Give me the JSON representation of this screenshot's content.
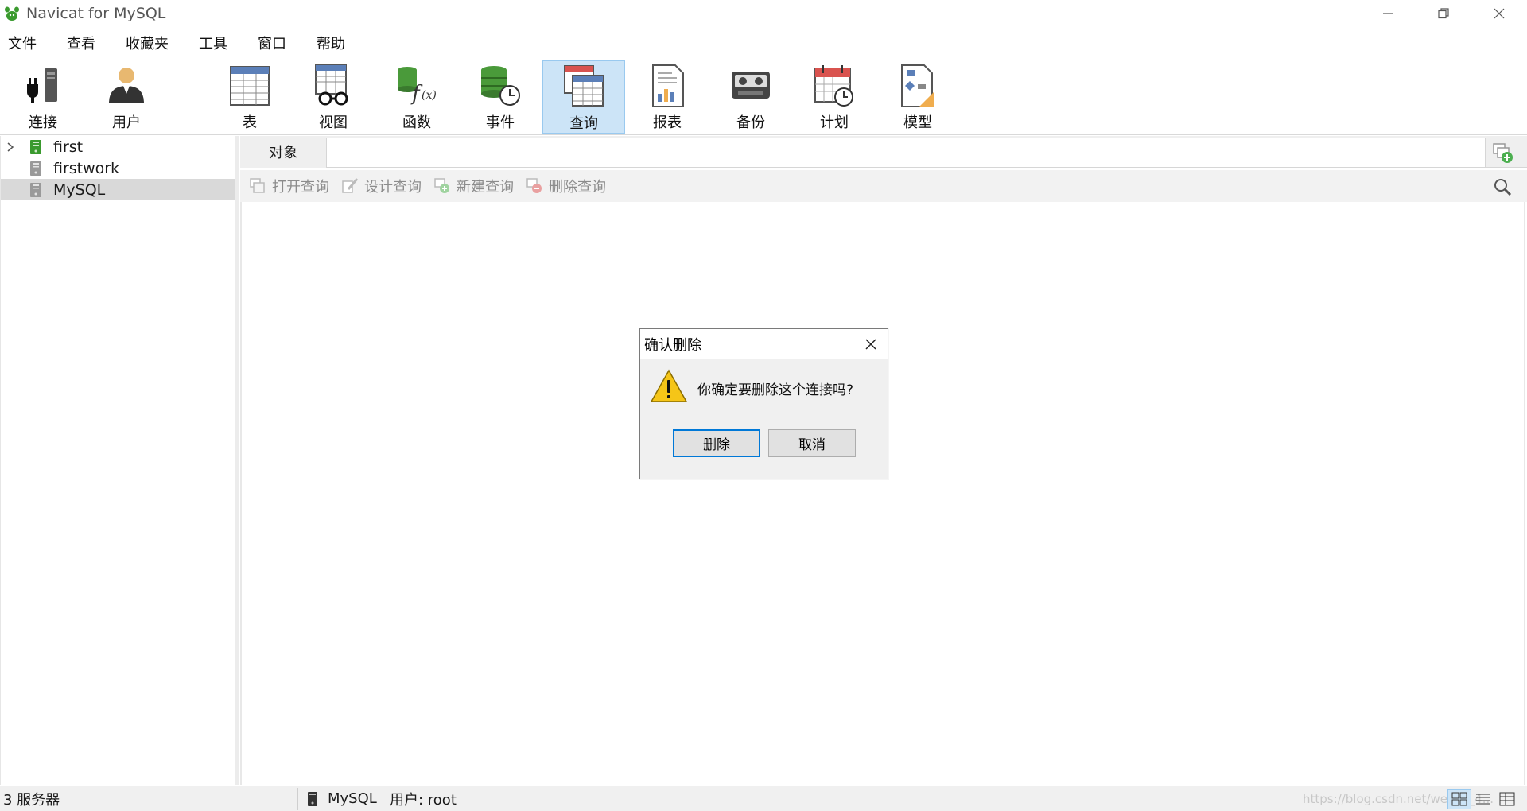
{
  "window": {
    "title": "Navicat for MySQL"
  },
  "menu": {
    "items": [
      "文件",
      "查看",
      "收藏夹",
      "工具",
      "窗口",
      "帮助"
    ]
  },
  "toolbar": {
    "items": [
      {
        "label": "连接",
        "icon": "connection-icon"
      },
      {
        "label": "用户",
        "icon": "user-icon"
      },
      {
        "label": "表",
        "icon": "table-icon"
      },
      {
        "label": "视图",
        "icon": "view-icon"
      },
      {
        "label": "函数",
        "icon": "function-icon"
      },
      {
        "label": "事件",
        "icon": "event-icon"
      },
      {
        "label": "查询",
        "icon": "query-icon",
        "active": true
      },
      {
        "label": "报表",
        "icon": "report-icon"
      },
      {
        "label": "备份",
        "icon": "backup-icon"
      },
      {
        "label": "计划",
        "icon": "schedule-icon"
      },
      {
        "label": "模型",
        "icon": "model-icon"
      }
    ]
  },
  "sidebar": {
    "connections": [
      {
        "label": "first",
        "expandable": true,
        "connected": true
      },
      {
        "label": "firstwork",
        "expandable": false,
        "connected": false
      },
      {
        "label": "MySQL",
        "expandable": false,
        "connected": false,
        "selected": true
      }
    ]
  },
  "tabs": {
    "object_tab": "对象"
  },
  "object_toolbar": {
    "open_query": "打开查询",
    "design_query": "设计查询",
    "new_query": "新建查询",
    "delete_query": "删除查询"
  },
  "dialog": {
    "title": "确认删除",
    "message": "你确定要删除这个连接吗?",
    "delete_button": "删除",
    "cancel_button": "取消"
  },
  "statusbar": {
    "server_count": "3 服务器",
    "connection": "MySQL",
    "user": "用户: root",
    "watermark": "https://blog.csdn.net/weixin_4..."
  },
  "colors": {
    "accent": "#0078d7",
    "active_tool_bg": "#cce4f7",
    "logo_green": "#3a9a2e"
  }
}
